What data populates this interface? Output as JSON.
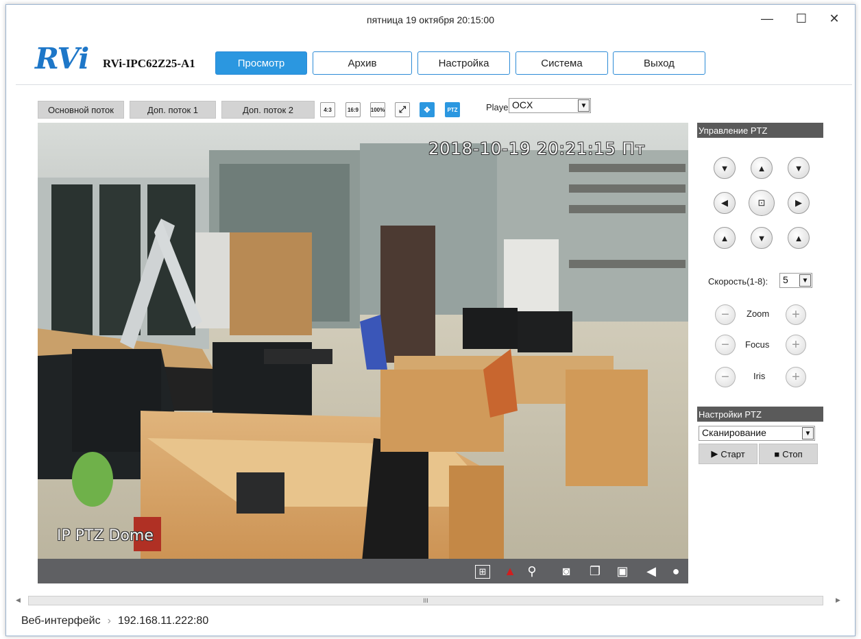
{
  "window": {
    "title": "пятница 19 октября 20:15:00",
    "minimize": "—",
    "maximize": "☐",
    "close": "✕"
  },
  "header": {
    "logo": "RVi",
    "model": "RVi-IPC62Z25-A1",
    "nav": [
      {
        "label": "Просмотр",
        "active": true
      },
      {
        "label": "Архив"
      },
      {
        "label": "Настройка"
      },
      {
        "label": "Система"
      },
      {
        "label": "Выход"
      }
    ]
  },
  "toolbar": {
    "streams": [
      "Основной поток",
      "Доп. поток 1",
      "Доп. поток 2"
    ],
    "ratio_buttons": [
      "4:3",
      "16:9",
      "100%"
    ],
    "ptz_badge": "PTZ",
    "player_label": "Player",
    "player_value": "OCX"
  },
  "video": {
    "osd_timestamp": "2018-10-19 20:21:15  Пт",
    "osd_name": "IP PTZ Dome"
  },
  "ptz": {
    "control_title": "Управление PTZ",
    "speed_label": "Скорость(1-8):",
    "speed_value": "5",
    "zoom_label": "Zoom",
    "focus_label": "Focus",
    "iris_label": "Iris",
    "settings_title": "Настройки PTZ",
    "mode_value": "Сканирование",
    "start_label": "Старт",
    "stop_label": "Стоп"
  },
  "statusbar": {
    "crumb": "Веб-интерфейс",
    "separator": "›",
    "address": "192.168.11.222:80"
  },
  "scrollbar": {
    "grip": "III"
  },
  "colors": {
    "accent": "#2b97e0",
    "panel_head": "#5a5a5a",
    "video_bar": "#5f6063"
  }
}
